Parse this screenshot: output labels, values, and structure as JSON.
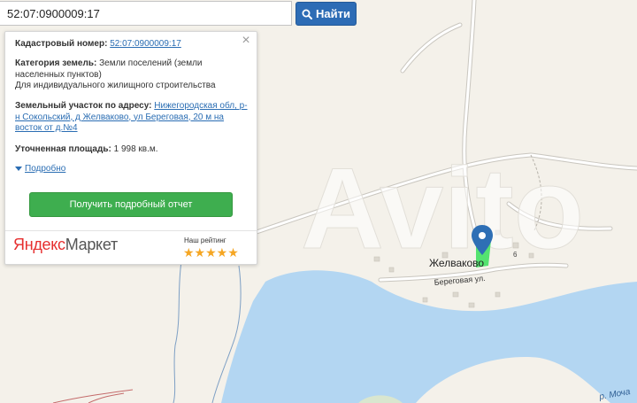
{
  "search": {
    "value": "52:07:0900009:17",
    "button_label": "Найти"
  },
  "card": {
    "cadastral_label": "Кадастровый номер:",
    "cadastral_value": "52:07:0900009:17",
    "category_label": "Категория земель:",
    "category_value": "Земли поселений (земли населенных пунктов)",
    "category_use": "Для индивидуального жилищного строительства",
    "address_label": "Земельный участок по адресу:",
    "address_value": "Нижегородская обл, р-н Сокольский, д Желваково, ул Береговая, 20 м на восток от д.№4",
    "area_label": "Уточненная площадь:",
    "area_value": "1 998 кв.м.",
    "details_label": "Подробно",
    "report_button": "Получить подробный отчет",
    "market_logo_1": "Яндекс",
    "market_logo_2": "Маркет",
    "rating_label": "Наш рейтинг",
    "rating_value": 5,
    "rating_stars": "★★★★★"
  },
  "map": {
    "village_label": "Желваково",
    "street_label": "Береговая ул.",
    "house_number": "6",
    "river_label": "р. Моча",
    "watermark": "Avito",
    "colors": {
      "land": "#f4f1ea",
      "water": "#b3d6f2",
      "parcel": "#37e05a",
      "marker": "#2e6fb5",
      "road": "#ffffff"
    }
  }
}
